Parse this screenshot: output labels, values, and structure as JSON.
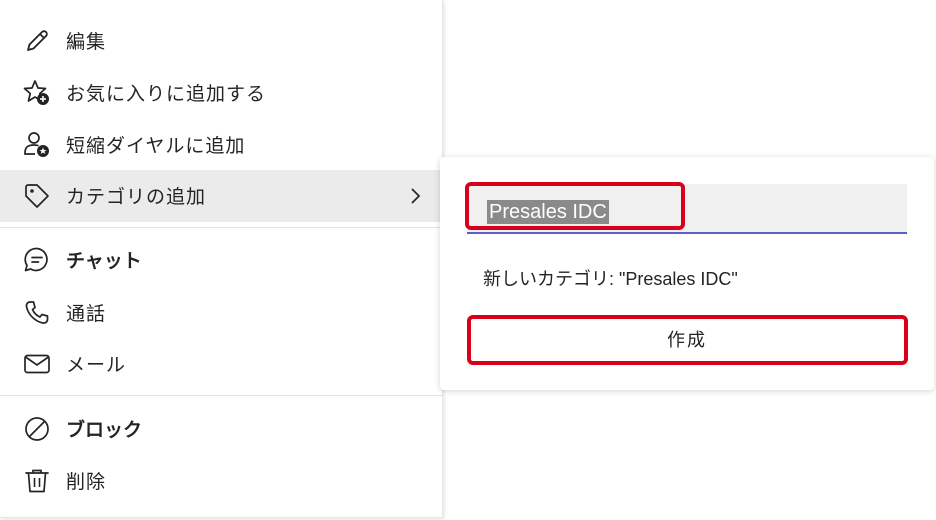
{
  "menu": {
    "edit": "編集",
    "add_favorite": "お気に入りに追加する",
    "add_speed_dial": "短縮ダイヤルに追加",
    "add_category": "カテゴリの追加",
    "chat": "チャット",
    "call": "通話",
    "mail": "メール",
    "block": "ブロック",
    "delete": "削除"
  },
  "category_panel": {
    "input_value": "Presales IDC",
    "suggestion_label": "新しいカテゴリ: \"Presales IDC\"",
    "create_label": "作成"
  },
  "colors": {
    "accent_underline": "#5b5fc7",
    "highlight_box": "#d9001b",
    "hover_row": "#ebebeb"
  }
}
